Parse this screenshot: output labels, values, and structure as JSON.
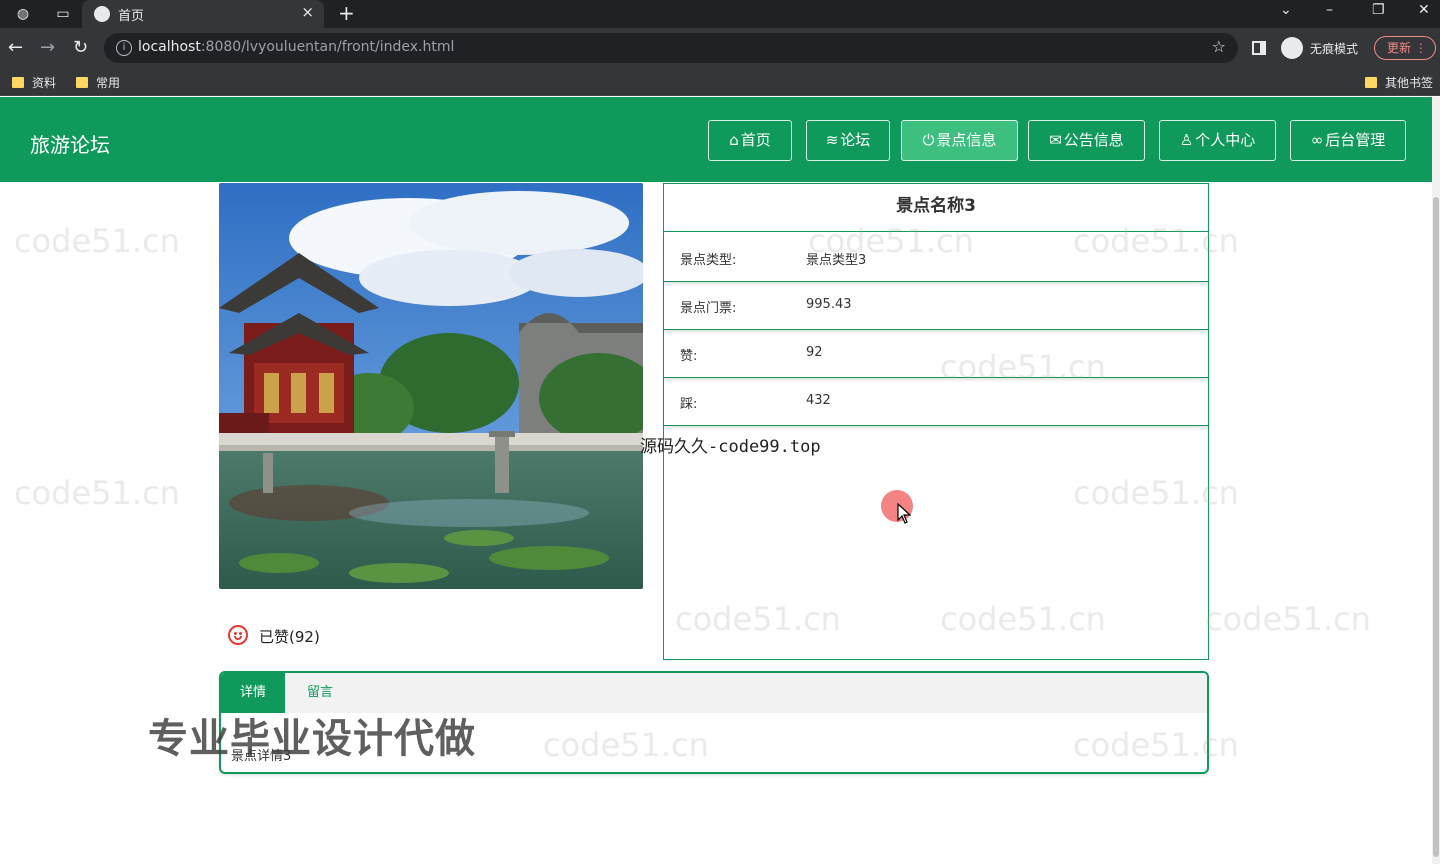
{
  "browser": {
    "tab_title": "首页",
    "url_host": "localhost",
    "url_rest": ":8080/lvyouluentan/front/index.html",
    "incognito_label": "无痕模式",
    "update_label": "更新",
    "bookmarks": [
      "资料",
      "常用"
    ],
    "other_bookmarks": "其他书签"
  },
  "site": {
    "title": "旅游论坛",
    "nav": [
      {
        "label": "首页",
        "icon": "home-icon"
      },
      {
        "label": "论坛",
        "icon": "forum-icon"
      },
      {
        "label": "景点信息",
        "icon": "power-icon",
        "active": true
      },
      {
        "label": "公告信息",
        "icon": "mail-icon"
      },
      {
        "label": "个人中心",
        "icon": "user-icon"
      },
      {
        "label": "后台管理",
        "icon": "link-icon"
      }
    ],
    "accent_color": "#0f9a5b"
  },
  "spot": {
    "name": "景点名称3",
    "rows": [
      {
        "label": "景点类型:",
        "value": "景点类型3"
      },
      {
        "label": "景点门票:",
        "value": "995.43"
      },
      {
        "label": "赞:",
        "value": "92"
      },
      {
        "label": "踩:",
        "value": "432"
      }
    ],
    "liked_label": "已赞(92)"
  },
  "detail": {
    "tabs": [
      "详情",
      "留言"
    ],
    "content": "景点详情3"
  },
  "overlays": {
    "watermark": "code51.cn",
    "code_text": "源码久久-code99.top",
    "promo_text": "专业毕业设计代做"
  }
}
